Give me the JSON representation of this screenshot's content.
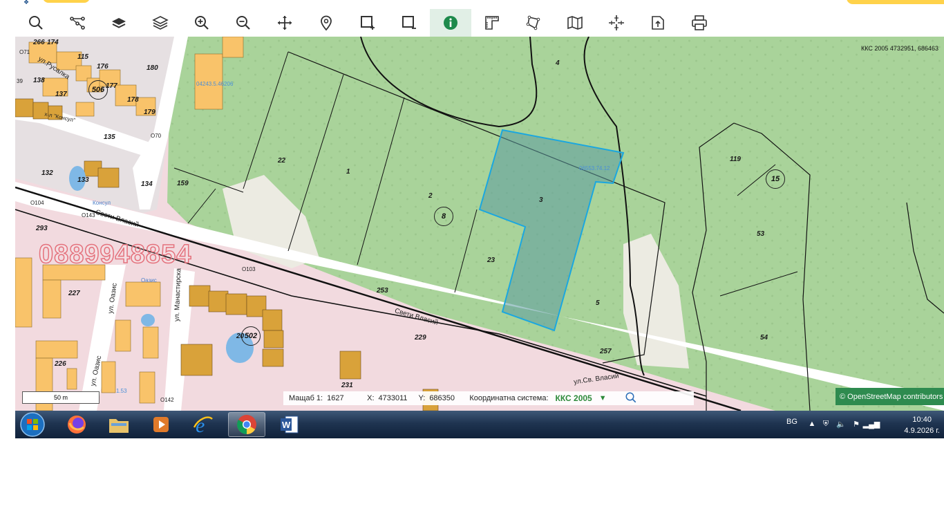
{
  "toolbar": {
    "buttons": [
      {
        "name": "search-tool-button",
        "icon": "search-icon"
      },
      {
        "name": "route-tool-button",
        "icon": "route-icon"
      },
      {
        "name": "layer-tool-button",
        "icon": "layer-icon"
      },
      {
        "name": "layers-tool-button",
        "icon": "layers-icon"
      },
      {
        "name": "zoom-in-button",
        "icon": "zoom-in-icon"
      },
      {
        "name": "zoom-out-button",
        "icon": "zoom-out-icon"
      },
      {
        "name": "pan-button",
        "icon": "move-icon"
      },
      {
        "name": "place-marker-button",
        "icon": "map-pin-icon"
      },
      {
        "name": "select-area-button",
        "icon": "select-plus-icon"
      },
      {
        "name": "deselect-area-button",
        "icon": "select-minus-icon"
      },
      {
        "name": "info-button",
        "icon": "info-icon",
        "active": true
      },
      {
        "name": "measure-distance-button",
        "icon": "ruler-icon"
      },
      {
        "name": "measure-area-button",
        "icon": "polygon-icon"
      },
      {
        "name": "map-view-button",
        "icon": "map-icon"
      },
      {
        "name": "coordinates-button",
        "icon": "crosshair-icon"
      },
      {
        "name": "export-button",
        "icon": "export-icon"
      },
      {
        "name": "print-button",
        "icon": "printer-icon"
      }
    ]
  },
  "map": {
    "coord_readout": "ККС 2005 4732951, 686463",
    "watermark": "0889948854",
    "parcels": [
      "266",
      "174",
      "115",
      "176",
      "180",
      "177",
      "178",
      "179",
      "138",
      "137",
      "135",
      "132",
      "133",
      "134",
      "159",
      "22",
      "1",
      "2",
      "3",
      "4",
      "23",
      "5",
      "253",
      "257",
      "229",
      "227",
      "226",
      "231",
      "119",
      "53",
      "54",
      "293",
      "20"
    ],
    "numbered_circles": [
      "506",
      "8",
      "15",
      "502"
    ],
    "streets": [
      "Свети Власий",
      "Свети Власий",
      "ул.Св. Власий",
      "ул. Манастирска",
      "ул. Оазис",
      "ул. Оазис",
      "ул.Русалка"
    ],
    "small_labels": [
      "О71",
      "О70",
      "О104",
      "О143",
      "О103",
      "О142",
      "39",
      "х-л \"Консул\"",
      "Консул",
      "Оазис"
    ],
    "blue_ids": [
      "04243.5.46206",
      "06553.74.12",
      "1.53"
    ],
    "highlight_parcel": "3"
  },
  "scale": {
    "label": "50 m"
  },
  "status": {
    "scale_label": "Мащаб 1:",
    "scale_value": "1627",
    "x_label": "X:",
    "x_value": "4733011",
    "y_label": "Y:",
    "y_value": "686350",
    "crs_label": "Координатна система:",
    "crs_value": "ККС 2005",
    "crs_arrow": "▼"
  },
  "attribution": "© OpenStreetMap contributors",
  "taskbar": {
    "apps": [
      "start-orb",
      "firefox",
      "file-explorer",
      "media-player",
      "internet-explorer",
      "chrome",
      "word"
    ],
    "active_app": "chrome",
    "language": "BG",
    "time": "10:40",
    "date": "4.9.2026 г."
  },
  "colors": {
    "forest": "#a9d39a",
    "urban": "#f2dadf",
    "building": "#f9c36a",
    "building_dark": "#d9a23a",
    "highlight_fill": "#5b9aa0",
    "highlight_stroke": "#1aa7e0",
    "accent_green": "#2e8b4f",
    "info_active": "#1e8a4c"
  }
}
